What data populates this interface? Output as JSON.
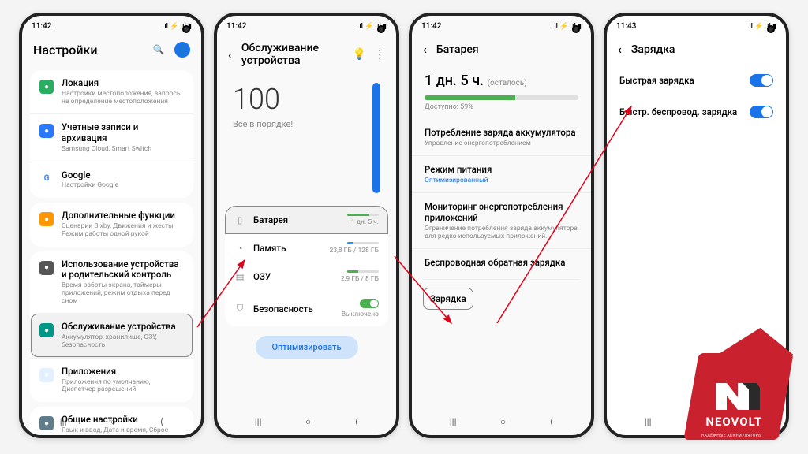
{
  "statusbar": {
    "time1": "11:42",
    "time4": "11:43",
    "signal": "📶 ⚡ 📶 ▮"
  },
  "phone1": {
    "title": "Настройки",
    "items": [
      {
        "title": "Локация",
        "sub": "Настройки местоположения, запросы на определение местоположения",
        "color": "#27ae60"
      },
      {
        "title": "Учетные записи и архивация",
        "sub": "Samsung Cloud, Smart Switch",
        "color": "#2979ff"
      },
      {
        "title": "Google",
        "sub": "Настройки Google",
        "color": "#fff"
      },
      {
        "title": "Дополнительные функции",
        "sub": "Сценарии Bixby, Движения и жесты, Режим работы одной рукой",
        "color": "#ff9800"
      },
      {
        "title": "Использование устройства и родительский контроль",
        "sub": "Время работы экрана, таймеры приложений, режим отдыха перед сном",
        "color": "#555"
      },
      {
        "title": "Обслуживание устройства",
        "sub": "Аккумулятор, хранилище, ОЗУ, безопасность",
        "color": "#009688",
        "highlight": true
      },
      {
        "title": "Приложения",
        "sub": "Приложения по умолчанию, Диспетчер разрешений",
        "color": "#e3f0ff"
      },
      {
        "title": "Общие настройки",
        "sub": "Язык и ввод, Дата и время, Сброс",
        "color": "#607d8b"
      }
    ]
  },
  "phone2": {
    "title": "Обслуживание устройства",
    "score": "100",
    "score_sub": "Все в порядке!",
    "rows": [
      {
        "label": "Батарея",
        "value": "1 дн. 5 ч.",
        "highlight": true
      },
      {
        "label": "Память",
        "value": "23,8 ГБ / 128 ГБ"
      },
      {
        "label": "ОЗУ",
        "value": "2,9 ГБ / 8 ГБ"
      },
      {
        "label": "Безопасность",
        "value": "Выключено"
      }
    ],
    "button": "Оптимизировать"
  },
  "phone3": {
    "title": "Батарея",
    "time": "1 дн. 5 ч.",
    "time_rest": "(осталось)",
    "avail": "Доступно: 59%",
    "sections": [
      {
        "title": "Потребление заряда аккумулятора",
        "sub": "Управление энергопотреблением"
      },
      {
        "title": "Режим питания",
        "sub": "Оптимизированный",
        "blue": true
      },
      {
        "title": "Мониторинг энергопотребления приложений",
        "sub": "Ограничение потребления заряда аккумулятора для редко используемых приложений."
      },
      {
        "title": "Беспроводная обратная зарядка",
        "sub": ""
      }
    ],
    "charging": "Зарядка"
  },
  "phone4": {
    "title": "Зарядка",
    "toggles": [
      {
        "label": "Быстрая зарядка",
        "on": true
      },
      {
        "label": "Быстр. беспровод. зарядка",
        "on": true
      }
    ]
  },
  "logo": {
    "brand": "NEOVOLT",
    "tagline": "НАДЁЖНЫЕ АККУМУЛЯТОРЫ"
  }
}
